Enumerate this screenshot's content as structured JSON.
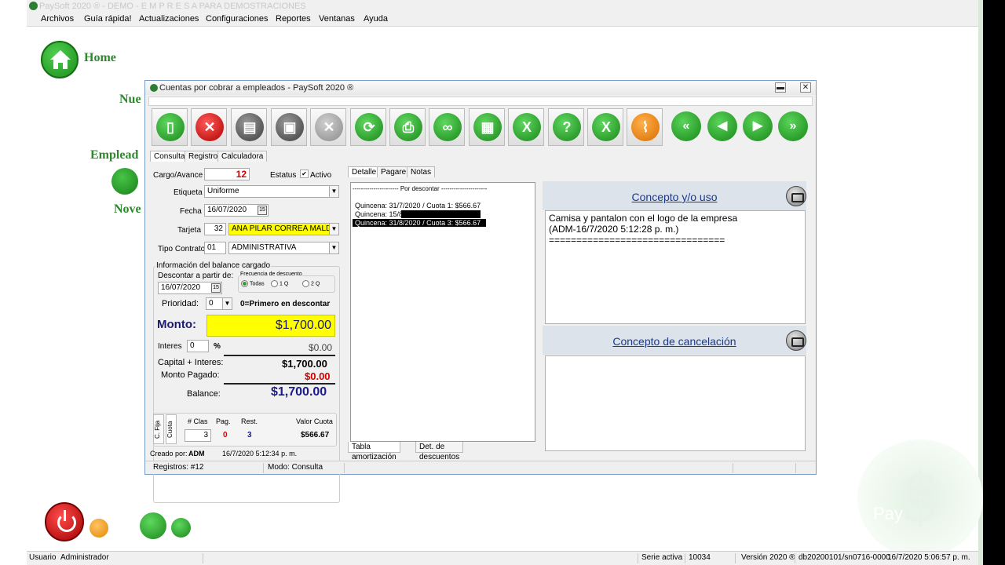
{
  "app": {
    "title": "PaySoft 2020 ® - DEMO - E M P R E S A PARA DEMOSTRACIONES",
    "menu": [
      "Archivos",
      "Guía rápida!",
      "Actualizaciones",
      "Configuraciones",
      "Reportes",
      "Ventanas",
      "Ayuda"
    ]
  },
  "left_nav": {
    "home": "Home",
    "nuevo": "Nue",
    "empleados": "Emplead",
    "novedades": "Nove"
  },
  "window": {
    "title": "Cuentas por cobrar a empleados - PaySoft 2020 ®",
    "min_label": "▬",
    "close_label": "✕",
    "toolbar": [
      "new-icon",
      "delete-icon",
      "copy-icon",
      "save-icon",
      "cancel-icon",
      "refresh-icon",
      "print-icon",
      "search-icon",
      "calculator-icon",
      "excel-icon",
      "help-icon",
      "excel-export-icon",
      "clear-icon",
      "first-icon",
      "prev-icon",
      "next-icon",
      "last-icon"
    ],
    "tabs": [
      "Consulta",
      "Registro",
      "Calculadora"
    ]
  },
  "form": {
    "cargo_label": "Cargo/Avance",
    "cargo_value": "12",
    "estatus_label": "Estatus",
    "activo_label": "Activo",
    "activo_checked": "✔",
    "etiqueta_label": "Etiqueta",
    "etiqueta_value": "Uniforme",
    "fecha_label": "Fecha",
    "fecha_value": "16/07/2020",
    "tarjeta_label": "Tarjeta",
    "tarjeta_num": "32",
    "tarjeta_name": "ANA PILAR CORREA MALDO",
    "tipo_label": "Tipo Contrato",
    "tipo_code": "01",
    "tipo_name": "ADMINISTRATIVA",
    "balance_group": "Información del balance cargado",
    "descontar_label": "Descontar a partir de:",
    "descontar_value": "16/07/2020",
    "frecuencia_label": "Frecuencia de descuento",
    "freq_todas": "Todas",
    "freq_1q": "1 Q",
    "freq_2q": "2 Q",
    "prioridad_label": "Prioridad:",
    "prioridad_value": "0",
    "prioridad_note": "0=Primero en descontar",
    "monto_label": "Monto:",
    "monto_value": "$1,700.00",
    "interes_label": "Interes",
    "interes_value": "0",
    "interes_pct": "%",
    "interes_amount": "$0.00",
    "capital_label": "Capital + Interes:",
    "capital_value": "$1,700.00",
    "pagado_label": "Monto Pagado:",
    "pagado_value": "$0.00",
    "balance_label": "Balance:",
    "balance_value": "$1,700.00",
    "cfija_label": "C. Fija",
    "cuota_tab": "Cuota",
    "clas_label": "# Clas",
    "pag_label": "Pag.",
    "rest_label": "Rest.",
    "valor_label": "Valor Cuota",
    "clas_value": "3",
    "pag_value": "0",
    "rest_value": "3",
    "valor_value": "$566.67",
    "creado_label": "Creado por:",
    "creado_user": "ADM",
    "creado_date": "16/7/2020 5:12:34 p. m."
  },
  "detail": {
    "tabs": [
      "Detalle",
      "Pagare",
      "Notas"
    ],
    "list_header": "---------------------- Por descontar ----------------------",
    "items": [
      "Quincena: 31/7/2020 / Cuota 1: $566.67",
      "Quincena: 15/8/2020 / Cuota 2: $566.67",
      "Quincena: 31/8/2020 / Cuota 3: $566.67"
    ],
    "bottom_tabs": [
      "Tabla amortización",
      "Det. de descuentos"
    ]
  },
  "concepto": {
    "title": "Concepto y/o uso",
    "text_line1": "Camisa y pantalon con el logo de la empresa",
    "text_line2": "(ADM-16/7/2020 5:12:28 p. m.)",
    "text_line3": "================================"
  },
  "cancelacion": {
    "title": "Concepto de cancelación"
  },
  "statusbar": {
    "registros": "Registros: #12",
    "modo": "Modo: Consulta"
  },
  "bottom_status": {
    "usuario_label": "Usuario",
    "usuario_value": "Administrador",
    "serie_label": "Serie activa",
    "serie_value": "10034",
    "version": "Versión 2020 ®",
    "db": "db20200101/sn0716-0000",
    "datetime": "16/7/2020 5:06:57 p. m."
  },
  "watermark": "Pay",
  "watermark_symbol": "$",
  "colors": {
    "green": "#2c8a2c",
    "yellow": "#ffff00",
    "red": "#d00000",
    "navy": "#1a1a8a"
  }
}
